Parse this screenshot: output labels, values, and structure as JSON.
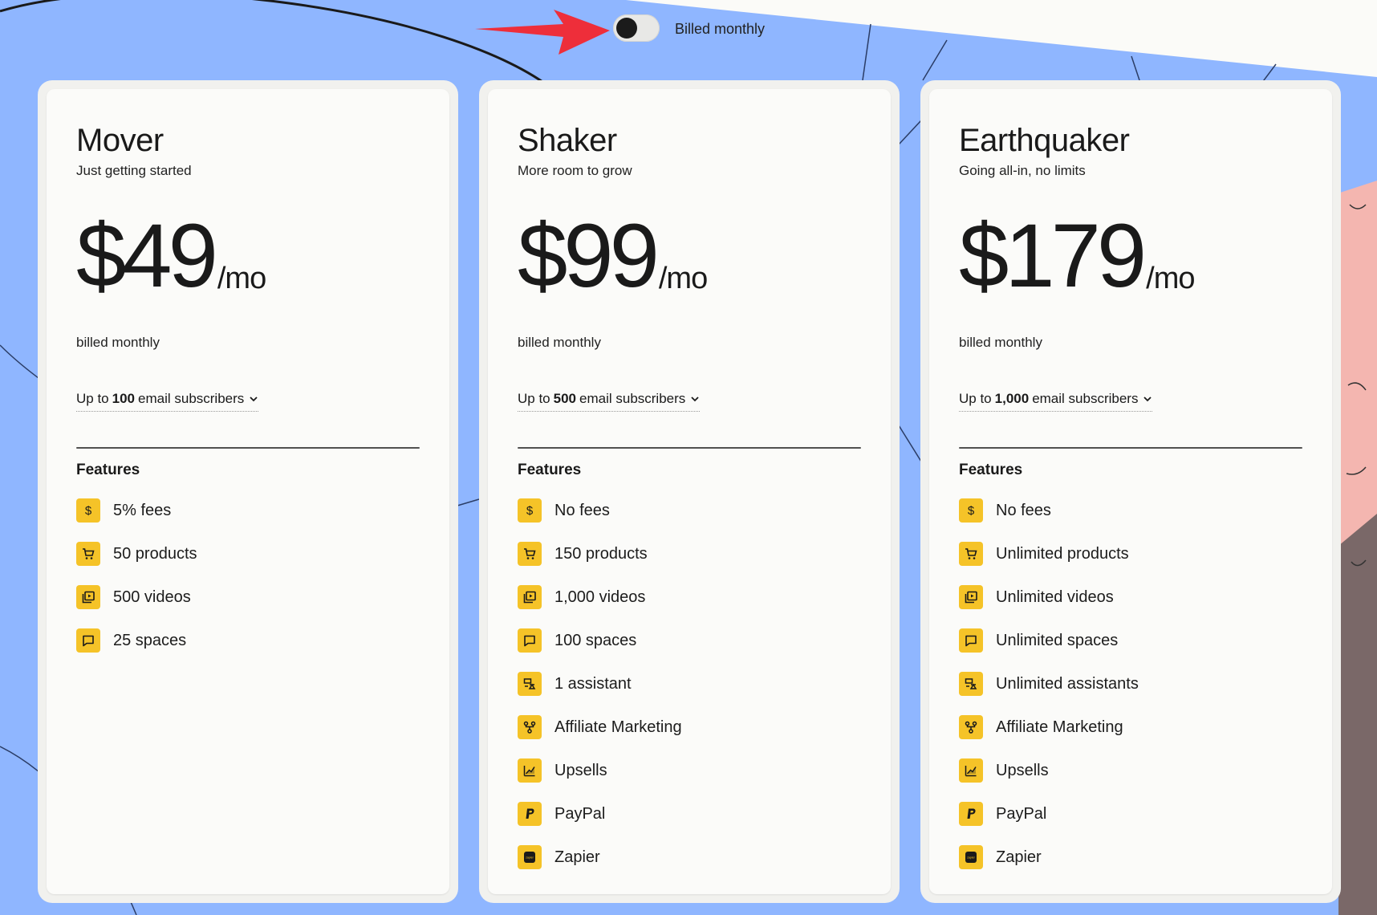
{
  "billing_toggle": {
    "label": "Billed monthly",
    "state": "monthly"
  },
  "accent_color": "#f5c328",
  "background_color": "#8fb6ff",
  "plans": [
    {
      "name": "Mover",
      "tagline": "Just getting started",
      "price": "$49",
      "per": "/mo",
      "billed": "billed monthly",
      "subs_prefix": "Up to",
      "subs_count": "100",
      "subs_suffix": "email subscribers",
      "features_title": "Features",
      "features": [
        {
          "icon": "dollar-icon",
          "text": "5% fees"
        },
        {
          "icon": "cart-icon",
          "text": "50 products"
        },
        {
          "icon": "video-icon",
          "text": "500 videos"
        },
        {
          "icon": "chat-icon",
          "text": "25 spaces"
        }
      ]
    },
    {
      "name": "Shaker",
      "tagline": "More room to grow",
      "price": "$99",
      "per": "/mo",
      "billed": "billed monthly",
      "subs_prefix": "Up to",
      "subs_count": "500",
      "subs_suffix": "email subscribers",
      "features_title": "Features",
      "features": [
        {
          "icon": "dollar-icon",
          "text": "No fees"
        },
        {
          "icon": "cart-icon",
          "text": "150 products"
        },
        {
          "icon": "video-icon",
          "text": "1,000 videos"
        },
        {
          "icon": "chat-icon",
          "text": "100 spaces"
        },
        {
          "icon": "assistant-icon",
          "text": "1 assistant"
        },
        {
          "icon": "affiliate-icon",
          "text": "Affiliate Marketing"
        },
        {
          "icon": "upsell-icon",
          "text": "Upsells"
        },
        {
          "icon": "paypal-icon",
          "text": "PayPal"
        },
        {
          "icon": "zapier-icon",
          "text": "Zapier"
        }
      ]
    },
    {
      "name": "Earthquaker",
      "tagline": "Going all-in, no limits",
      "price": "$179",
      "per": "/mo",
      "billed": "billed monthly",
      "subs_prefix": "Up to",
      "subs_count": "1,000",
      "subs_suffix": "email subscribers",
      "features_title": "Features",
      "features": [
        {
          "icon": "dollar-icon",
          "text": "No fees"
        },
        {
          "icon": "cart-icon",
          "text": "Unlimited products"
        },
        {
          "icon": "video-icon",
          "text": "Unlimited videos"
        },
        {
          "icon": "chat-icon",
          "text": "Unlimited spaces"
        },
        {
          "icon": "assistant-icon",
          "text": "Unlimited assistants"
        },
        {
          "icon": "affiliate-icon",
          "text": "Affiliate Marketing"
        },
        {
          "icon": "upsell-icon",
          "text": "Upsells"
        },
        {
          "icon": "paypal-icon",
          "text": "PayPal"
        },
        {
          "icon": "zapier-icon",
          "text": "Zapier"
        }
      ]
    }
  ]
}
